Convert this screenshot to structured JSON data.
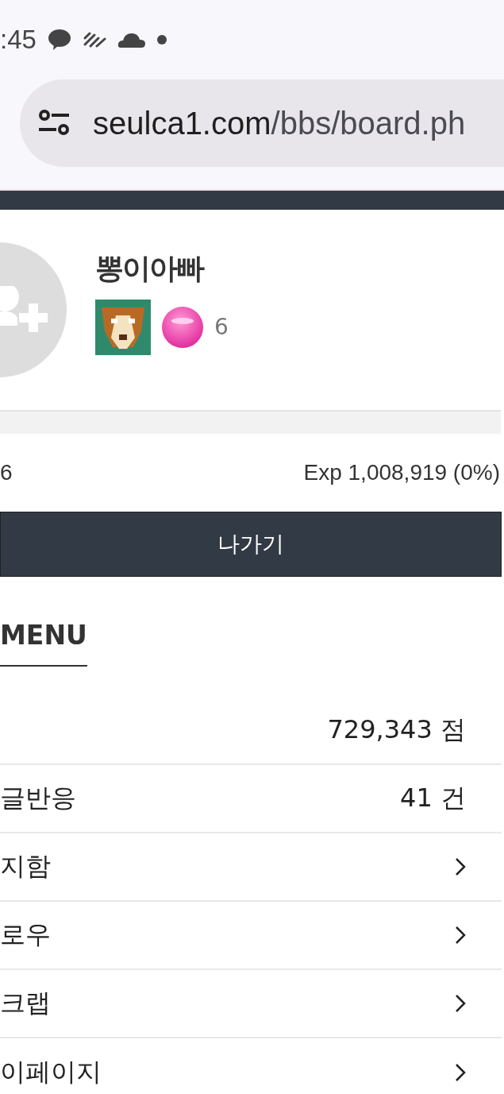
{
  "status_bar": {
    "time": ":45"
  },
  "address_bar": {
    "domain": "seulca1.com",
    "path": "/bbs/board.ph"
  },
  "profile": {
    "name": "뽕이아빠",
    "level_number": "6",
    "level": 0.0,
    "level_label": "6",
    "exp": "Exp 1,008,919 (0%)"
  },
  "logout_button": "나가기",
  "menu": {
    "title": "MENU",
    "items": [
      {
        "kind": "value",
        "value": "729,343 점"
      },
      {
        "kind": "value",
        "label": "글반응",
        "value": "41 건"
      },
      {
        "kind": "link",
        "label": "지함"
      },
      {
        "kind": "link",
        "label": "로우"
      },
      {
        "kind": "link",
        "label": "크랩"
      },
      {
        "kind": "link",
        "label": "이페이지"
      }
    ]
  }
}
